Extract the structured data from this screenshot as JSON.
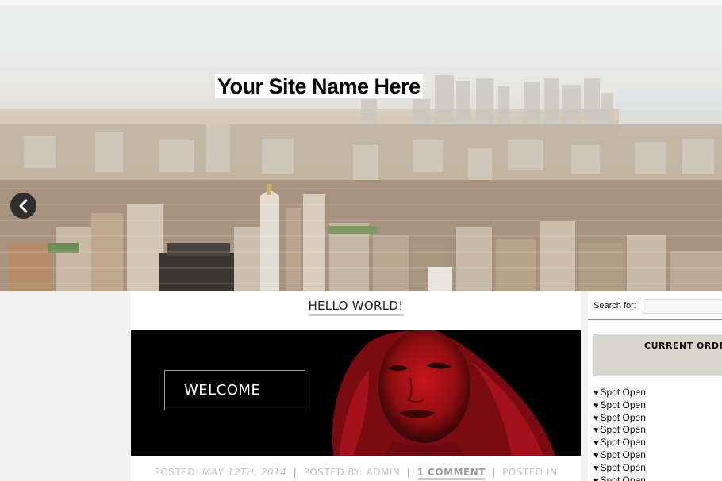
{
  "header": {
    "site_name": "Your Site Name Here",
    "prev_icon": "chevron-left-icon"
  },
  "post": {
    "title": "HELLO WORLD!",
    "banner_text": "WELCOME",
    "meta": {
      "posted_label": "POSTED:",
      "date": "MAY 12TH, 2014",
      "sep": "|",
      "by_label": "POSTED BY:",
      "author": "ADMIN",
      "comments": "1 COMMENT",
      "in_label": "POSTED IN"
    }
  },
  "sidebar": {
    "search_label": "Search for:",
    "search_value": "",
    "orders_title": "CURRENT ORDER",
    "spot_icon": "heart-icon",
    "spot_heart": "♥",
    "spots": [
      "Spot Open",
      "Spot Open",
      "Spot Open",
      "Spot Open",
      "Spot Open",
      "Spot Open",
      "Spot Open",
      "Spot Open"
    ]
  },
  "colors": {
    "banner_background": "#000000",
    "banner_accent": "#b3141c",
    "orders_box": "#d8d5cc",
    "link_underline": "#cfcfcf"
  }
}
